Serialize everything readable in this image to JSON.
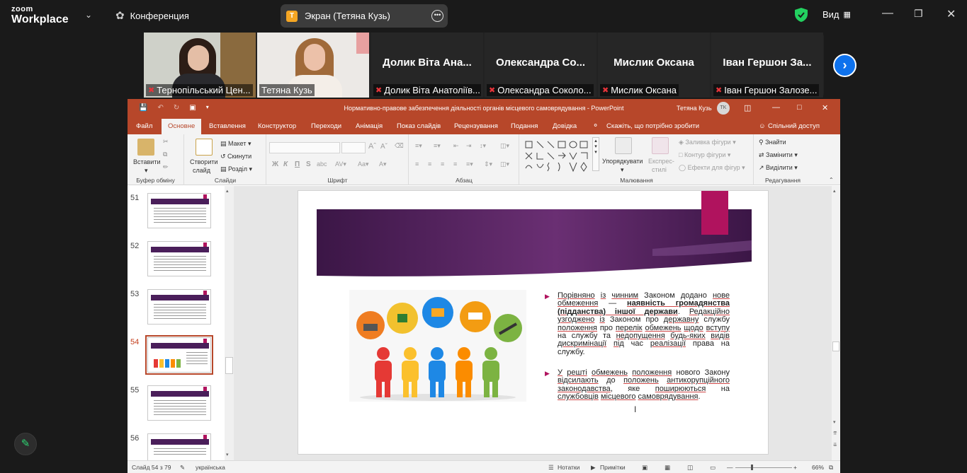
{
  "zoom": {
    "logo_top": "zoom",
    "logo_bottom": "Workplace",
    "meeting_label": "Конференция",
    "share_badge": "T",
    "share_title": "Экран (Тетяна Кузь)",
    "view_label": "Вид"
  },
  "participants": [
    {
      "name": "Тернопільський Цен...",
      "label": "Тернопільський Цен...",
      "video": true
    },
    {
      "name": "Тетяна Кузь",
      "label": "Тетяна Кузь",
      "video": true,
      "active": true
    },
    {
      "name": "Долик Віта Ана...",
      "label": "Долик Віта Анатоліїв...",
      "video": false
    },
    {
      "name": "Олександра Со...",
      "label": "Олександра Соколо...",
      "video": false
    },
    {
      "name": "Мислик Оксана",
      "label": "Мислик Оксана",
      "video": false
    },
    {
      "name": "Іван Гершон За...",
      "label": "Іван Гершон Залозе...",
      "video": false
    }
  ],
  "ppt": {
    "title": "Нормативно-правове забезпечення діяльності органів місцевого самоврядування - PowerPoint",
    "user": "Тетяна Кузь",
    "user_initials": "TK",
    "tabs": [
      "Файл",
      "Основне",
      "Вставлення",
      "Конструктор",
      "Переходи",
      "Анімація",
      "Показ слайдів",
      "Рецензування",
      "Подання",
      "Довідка"
    ],
    "tell_me": "Скажіть, що потрібно зробити",
    "share": "Спільний доступ",
    "ribbon": {
      "clipboard": {
        "paste": "Вставити",
        "label": "Буфер обміну"
      },
      "slides": {
        "new_slide_1": "Створити",
        "new_slide_2": "слайд",
        "layout": "Макет",
        "reset": "Скинути",
        "section": "Розділ",
        "label": "Слайди"
      },
      "font": {
        "bold": "Ж",
        "italic": "К",
        "underline": "П",
        "strike": "S",
        "label": "Шрифт"
      },
      "paragraph": {
        "label": "Абзац"
      },
      "drawing": {
        "arrange": "Упорядкувати",
        "quick_styles_1": "Експрес-",
        "quick_styles_2": "стилі",
        "fill": "Заливка фігури",
        "outline": "Контур фігури",
        "effects": "Ефекти для фігур",
        "label": "Малювання"
      },
      "editing": {
        "find": "Знайти",
        "replace": "Замінити",
        "select": "Виділити",
        "label": "Редагування"
      }
    },
    "thumbnails": [
      {
        "num": "51",
        "selected": false
      },
      {
        "num": "52",
        "selected": false
      },
      {
        "num": "53",
        "selected": false
      },
      {
        "num": "54",
        "selected": true
      },
      {
        "num": "55",
        "selected": false
      },
      {
        "num": "56",
        "selected": false
      }
    ],
    "status": {
      "slide_info": "Слайд 54 з 79",
      "language": "українська",
      "notes": "Нотатки",
      "comments": "Примітки",
      "zoom": "66%"
    }
  },
  "slide": {
    "accent_color": "#4a1e5a",
    "pin_color": "#b0135e"
  }
}
